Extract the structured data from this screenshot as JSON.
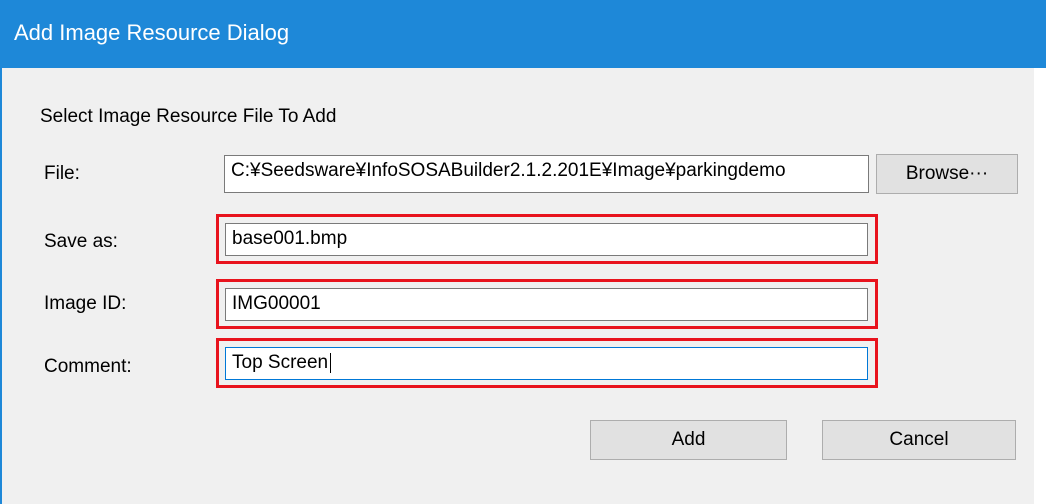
{
  "window": {
    "title": "Add Image Resource Dialog"
  },
  "dialog": {
    "instruction": "Select Image Resource File To Add",
    "file": {
      "label": "File:",
      "value": "C:¥Seedsware¥InfoSOSABuilder2.1.2.201E¥Image¥parkingdemo",
      "browse_label": "Browse···"
    },
    "save_as": {
      "label": "Save as:",
      "value": "base001.bmp"
    },
    "image_id": {
      "label": "Image ID:",
      "value": "IMG00001"
    },
    "comment": {
      "label": "Comment:",
      "value": "Top Screen"
    },
    "add_label": "Add",
    "cancel_label": "Cancel"
  },
  "colors": {
    "titlebar": "#1e88d8",
    "highlight": "#e8131d",
    "dialog_bg": "#f0f0f0"
  }
}
